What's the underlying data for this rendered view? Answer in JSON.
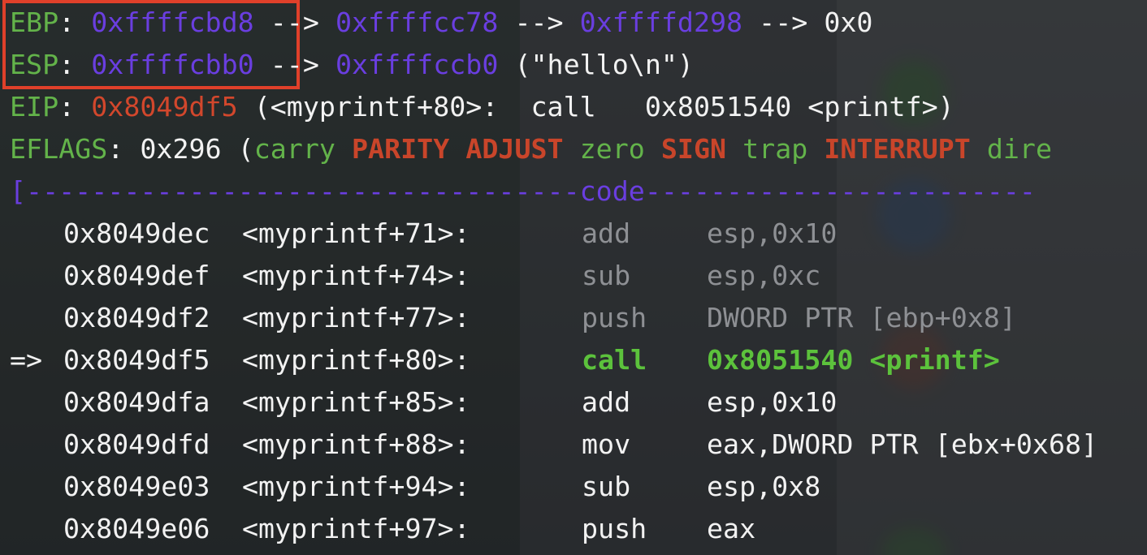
{
  "registers": {
    "ebp": {
      "label": "EBP",
      "colon": ": ",
      "value": "0xffffcbd8",
      "arrow1": " --> ",
      "chain1": "0xffffcc78",
      "arrow2": " --> ",
      "chain2": "0xffffd298",
      "arrow3": " --> ",
      "chain3": "0x0"
    },
    "esp": {
      "label": "ESP",
      "colon": ": ",
      "value": "0xffffcbb0",
      "arrow1": " --> ",
      "chain1": "0xffffccb0",
      "string": " (\"hello\\n\")"
    },
    "eip": {
      "label": "EIP",
      "colon": ": ",
      "value": "0x8049df5",
      "rest": " (<myprintf+80>:  call   0x8051540 <printf>)"
    },
    "eflags": {
      "label": "EFLAGS",
      "colon": ": ",
      "value": "0x296 (",
      "flags": [
        "carry",
        "PARITY",
        "ADJUST",
        "zero",
        "SIGN",
        "trap",
        "INTERRUPT",
        "dire"
      ]
    }
  },
  "code_separator": {
    "left": "[",
    "dashes_left": "----------------------------------",
    "title": "code",
    "dashes_right": "------------------------"
  },
  "code": [
    {
      "marker": "  ",
      "address": "0x8049dec",
      "symbol": "<myprintf+71>:",
      "mnemonic": "add",
      "operands": "esp,0x10",
      "state": "past"
    },
    {
      "marker": "  ",
      "address": "0x8049def",
      "symbol": "<myprintf+74>:",
      "mnemonic": "sub",
      "operands": "esp,0xc",
      "state": "past"
    },
    {
      "marker": "  ",
      "address": "0x8049df2",
      "symbol": "<myprintf+77>:",
      "mnemonic": "push",
      "operands": "DWORD PTR [ebp+0x8]",
      "state": "past"
    },
    {
      "marker": "=>",
      "address": "0x8049df5",
      "symbol": "<myprintf+80>:",
      "mnemonic": "call",
      "operands": "0x8051540 <printf>",
      "state": "current"
    },
    {
      "marker": "  ",
      "address": "0x8049dfa",
      "symbol": "<myprintf+85>:",
      "mnemonic": "add",
      "operands": "esp,0x10",
      "state": "future"
    },
    {
      "marker": "  ",
      "address": "0x8049dfd",
      "symbol": "<myprintf+88>:",
      "mnemonic": "mov",
      "operands": "eax,DWORD PTR [ebx+0x68]",
      "state": "future"
    },
    {
      "marker": "  ",
      "address": "0x8049e03",
      "symbol": "<myprintf+94>:",
      "mnemonic": "sub",
      "operands": "esp,0x8",
      "state": "future"
    },
    {
      "marker": "  ",
      "address": "0x8049e06",
      "symbol": "<myprintf+97>:",
      "mnemonic": "push",
      "operands": "eax",
      "state": "future"
    }
  ],
  "colors": {
    "register_label": "#63b34a",
    "address_value": "#6a3ee0",
    "code_address": "#d2472c",
    "flag_set": "#c9452a",
    "current_instruction": "#5cc23c",
    "past_instruction": "#8e9094",
    "highlight_box": "#e0402a"
  }
}
